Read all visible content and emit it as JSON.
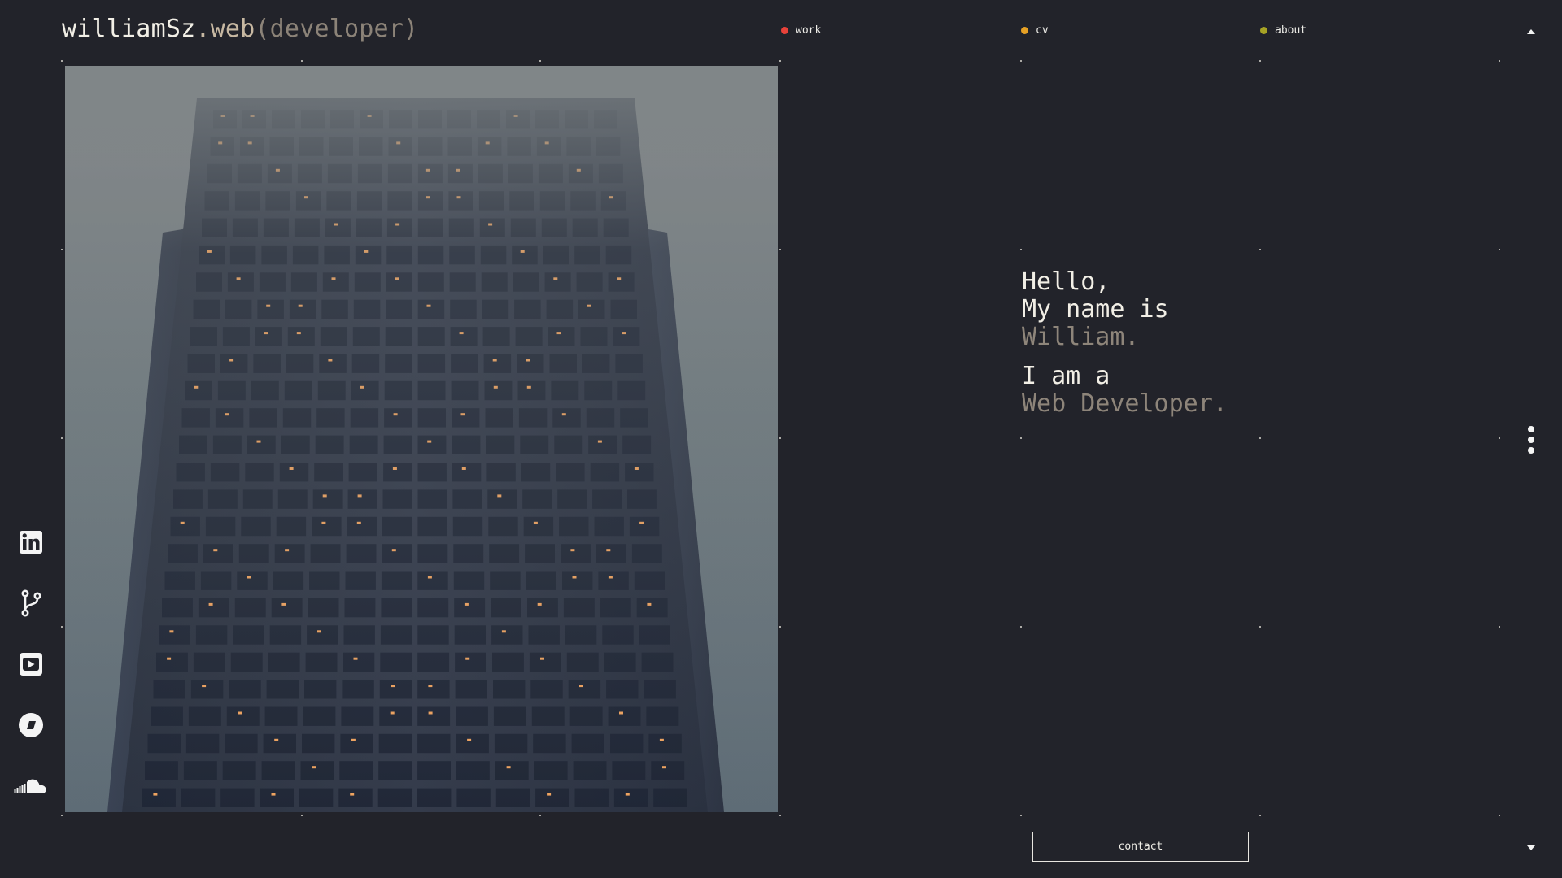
{
  "brand": {
    "name": "williamSz",
    "dot_web": ".web",
    "role": "(developer)"
  },
  "nav": {
    "items": [
      {
        "label": "work",
        "color": "#e8423a"
      },
      {
        "label": "cv",
        "color": "#e6a125"
      },
      {
        "label": "about",
        "color": "#a7a325"
      }
    ]
  },
  "intro": {
    "line1": "Hello,",
    "line2": "My name is",
    "line3": "William.",
    "line4": "I am a",
    "line5": "Web Developer."
  },
  "contact": {
    "label": "contact"
  },
  "social": [
    {
      "icon": "linkedin-icon"
    },
    {
      "icon": "git-branch-icon"
    },
    {
      "icon": "youtube-icon"
    },
    {
      "icon": "behance-circle-icon"
    },
    {
      "icon": "soundcloud-icon"
    }
  ],
  "colors": {
    "background": "#22232a",
    "text": "#f2efe6",
    "muted": "#8e857a"
  }
}
